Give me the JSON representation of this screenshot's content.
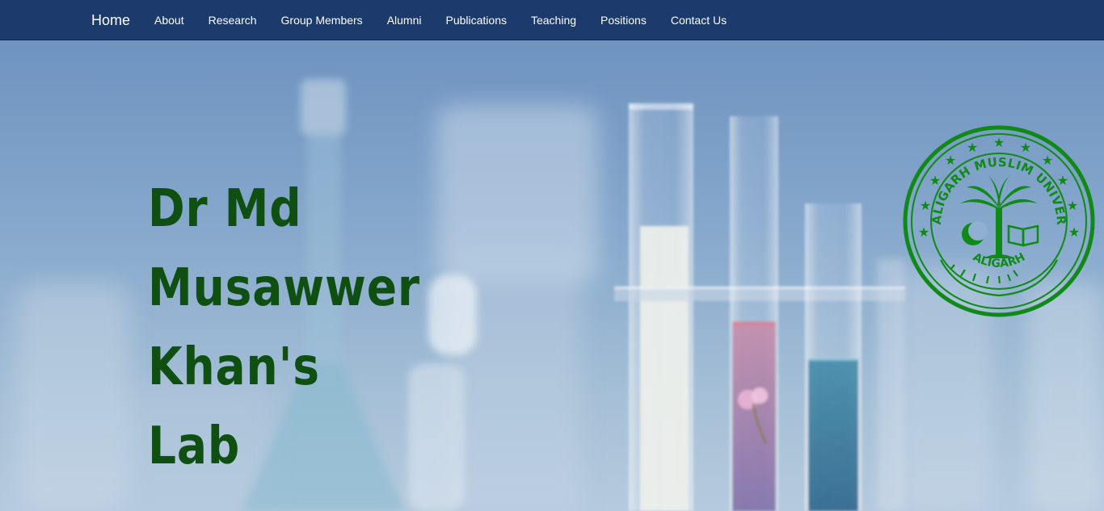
{
  "nav": {
    "brand": "Home",
    "items": [
      {
        "id": "about",
        "label": "About"
      },
      {
        "id": "research",
        "label": "Research"
      },
      {
        "id": "group-members",
        "label": "Group Members"
      },
      {
        "id": "alumni",
        "label": "Alumni"
      },
      {
        "id": "publications",
        "label": "Publications"
      },
      {
        "id": "teaching",
        "label": "Teaching"
      },
      {
        "id": "positions",
        "label": "Positions"
      },
      {
        "id": "contact-us",
        "label": "Contact Us"
      }
    ]
  },
  "hero": {
    "title_lines": [
      "Dr Md",
      "Musawwer",
      "Khan's Lab"
    ]
  },
  "seal": {
    "text_top": "THE ALIGARH MUSLIM UNIVERSITY",
    "text_bottom": "ALIGARH",
    "color": "#0f8a17"
  },
  "colors": {
    "navbar": "#1c3a6b",
    "title": "#0f4f12"
  }
}
